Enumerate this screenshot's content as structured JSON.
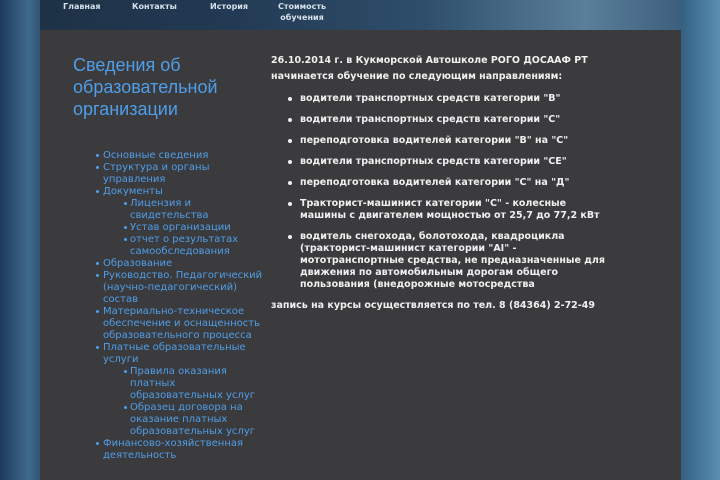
{
  "nav": {
    "items": [
      {
        "label": "Главная"
      },
      {
        "label": "Контакты"
      },
      {
        "label": "История"
      },
      {
        "label": "Стоимость обучения"
      }
    ]
  },
  "sidebar": {
    "title": "Сведения об образовательной организации",
    "items": [
      {
        "label": "Основные сведения"
      },
      {
        "label": "Структура и органы управления"
      },
      {
        "label": "Документы",
        "children": [
          {
            "label": "Лицензия и свидетельства"
          },
          {
            "label": "Устав организации"
          },
          {
            "label": "отчет о результатах самообследования"
          }
        ]
      },
      {
        "label": "Образование"
      },
      {
        "label": "Руководство. Педагогический (научно-педагогический) состав"
      },
      {
        "label": "Материально-техническое обеспечение и оснащенность образовательного процесса"
      },
      {
        "label": "Платные образовательные услуги",
        "children": [
          {
            "label": "Правила оказания платных образовательных услуг"
          },
          {
            "label": "Образец договора на оказание платных образовательных услуг"
          }
        ]
      },
      {
        "label": "Финансово-хозяйственная деятельность"
      }
    ]
  },
  "content": {
    "intro": "26.10.2014 г. в Кукморской Автошколе РОГО ДОСААФ РТ начинается обучение по следующим направлениям:",
    "directions": [
      "водители транспортных средств категории \"В\"",
      "водители транспортных средств категории \"С\"",
      "переподготовка водителей категории \"В\" на \"С\"",
      "водители транспортных средств категории \"СЕ\"",
      "переподготовка водителей категории \"С\" на \"Д\"",
      "Тракторист-машинист категории \"С\" - колесные машины с двигателем мощностью от 25,7 до 77,2 кВт",
      "водитель снегохода, болотохода, квадроцикла (тракторист-машинист категории \"AI\" - мототранспортные средства, не предназначенные для движения по автомобильным дорогам общего пользования (внедорожные мотосредства"
    ],
    "signup": "запись на курсы осуществляется по тел. 8 (84364) 2-72-49"
  }
}
